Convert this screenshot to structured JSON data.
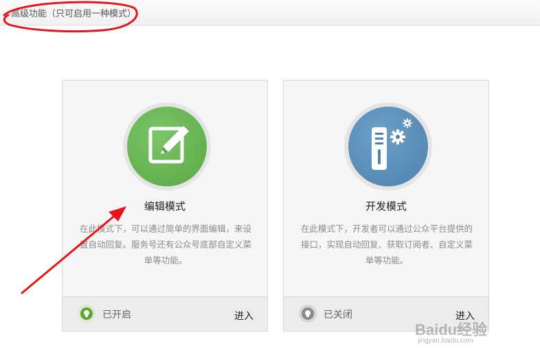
{
  "header": {
    "title": "高级功能（只可启用一种模式）"
  },
  "modes": [
    {
      "title": "编辑模式",
      "description": "在此模式下，可以通过简单的界面编辑，来设置自动回复。服务号还有公众号底部自定义菜单等功能。",
      "status": "已开启",
      "enter_label": "进入",
      "accent_color": "#5aa843",
      "status_color": "#5ea63a",
      "icon": "edit-pencil-icon"
    },
    {
      "title": "开发模式",
      "description": "在此模式下，开发者可以通过公众平台提供的接口，实现自动回复、获取订阅者、自定义菜单等功能。",
      "status": "已关闭",
      "enter_label": "进入",
      "accent_color": "#4d82ad",
      "status_color": "#8b8b8b",
      "icon": "server-gear-icon"
    }
  ],
  "watermark": {
    "brand": "Baidu经验",
    "url": "jingyan.baidu.com"
  }
}
